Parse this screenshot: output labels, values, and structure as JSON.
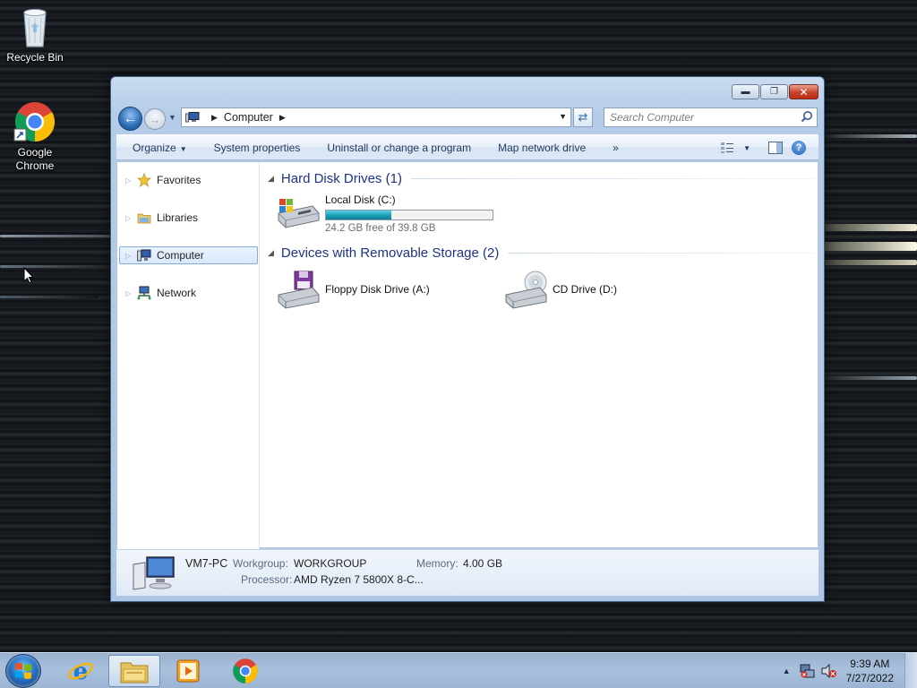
{
  "desktop": {
    "icons": [
      {
        "label": "Recycle Bin",
        "icon": "recycle-bin-icon"
      },
      {
        "label": "Google Chrome",
        "icon": "chrome-icon"
      }
    ]
  },
  "window": {
    "address": {
      "segments": [
        "Computer"
      ]
    },
    "search": {
      "placeholder": "Search Computer"
    },
    "commands": {
      "organize": "Organize",
      "system_properties": "System properties",
      "uninstall": "Uninstall or change a program",
      "map_drive": "Map network drive",
      "more": "»"
    },
    "nav": {
      "items": [
        {
          "label": "Favorites",
          "icon": "star-icon"
        },
        {
          "label": "Libraries",
          "icon": "libraries-icon"
        },
        {
          "label": "Computer",
          "icon": "computer-icon",
          "selected": true
        },
        {
          "label": "Network",
          "icon": "network-icon"
        }
      ]
    },
    "groups": {
      "hard_disks": {
        "title": "Hard Disk Drives (1)",
        "drives": [
          {
            "name": "Local Disk (C:)",
            "free_text": "24.2 GB free of 39.8 GB",
            "used_fraction": 0.39
          }
        ]
      },
      "removable": {
        "title": "Devices with Removable Storage (2)",
        "drives": [
          {
            "name": "Floppy Disk Drive (A:)",
            "icon": "floppy-drive-icon"
          },
          {
            "name": "CD Drive (D:)",
            "icon": "cd-drive-icon"
          }
        ]
      }
    },
    "details": {
      "name": "VM7-PC",
      "workgroup_label": "Workgroup:",
      "workgroup": "WORKGROUP",
      "memory_label": "Memory:",
      "memory": "4.00 GB",
      "processor_label": "Processor:",
      "processor": "AMD Ryzen 7 5800X 8-C..."
    }
  },
  "taskbar": {
    "clock": {
      "time": "9:39 AM",
      "date": "7/27/2022"
    }
  },
  "colors": {
    "group_title": "#1e3287",
    "progress_fill": "#1a9db8",
    "taskbar": "#a9c1dd"
  }
}
